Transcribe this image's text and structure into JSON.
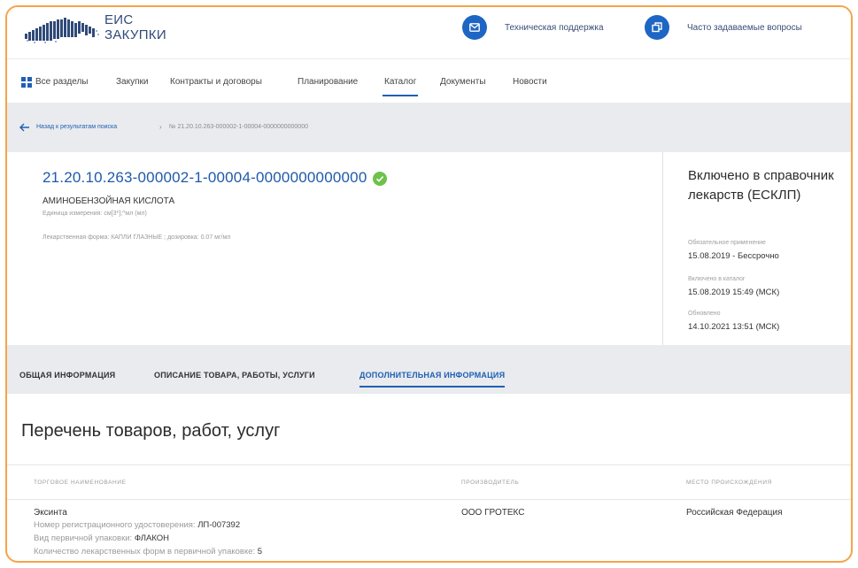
{
  "header": {
    "logo_line1": "ЕИС",
    "logo_line2": "ЗАКУПКИ",
    "support_label": "Техническая поддержка",
    "faq_label": "Часто задаваемые вопросы"
  },
  "nav": {
    "items": [
      "Все разделы",
      "Закупки",
      "Контракты и договоры",
      "Планирование",
      "Каталог",
      "Документы",
      "Новости"
    ],
    "active": "Каталог"
  },
  "breadcrumb": {
    "back": "Назад к результатам поиска",
    "separator": "›",
    "current": "№ 21.20.10.263-000002-1-00004-0000000000000"
  },
  "item": {
    "code": "21.20.10.263-000002-1-00004-0000000000000",
    "name": "АМИНОБЕНЗОЙНАЯ КИСЛОТА",
    "unit": "Единица измерения: см[3*];^мл (мл)",
    "form": "Лекарственная форма: КАПЛИ ГЛАЗНЫЕ ; дозировка: 0.07 мг/мл"
  },
  "status": {
    "title": "Включено в справочник лекарств (ЕСКЛП)",
    "mandatory_label": "Обязательное применение",
    "mandatory_value": "15.08.2019  - Бессрочно",
    "included_label": "Включено в каталог",
    "included_value": "15.08.2019 15:49 (МСК)",
    "updated_label": "Обновлено",
    "updated_value": "14.10.2021 13:51 (МСК)"
  },
  "tabs": {
    "items": [
      "ОБЩАЯ ИНФОРМАЦИЯ",
      "ОПИСАНИЕ ТОВАРА, РАБОТЫ, УСЛУГИ",
      "ДОПОЛНИТЕЛЬНАЯ ИНФОРМАЦИЯ"
    ],
    "active": "ДОПОЛНИТЕЛЬНАЯ ИНФОРМАЦИЯ"
  },
  "list": {
    "title": "Перечень товаров, работ, услуг",
    "headers": [
      "ТОРГОВОЕ НАИМЕНОВАНИЕ",
      "ПРОИЗВОДИТЕЛЬ",
      "МЕСТО ПРОИСХОЖДЕНИЯ"
    ],
    "row": {
      "trade_name": "Эксинта",
      "reg_label": "Номер регистрационного удостоверения:",
      "reg_value": "ЛП-007392",
      "pack_label": "Вид первичной упаковки:",
      "pack_value": "ФЛАКОН",
      "qty_label": "Количество лекарственных форм в первичной упаковке:",
      "qty_value": "5",
      "manufacturer": "ООО ГРОТЕКС",
      "origin": "Российская Федерация"
    }
  },
  "colors": {
    "brand_blue": "#1e66c4",
    "link_blue": "#1f5fb5",
    "frame_orange": "#f7a348",
    "check_green": "#6cc24a",
    "panel_gray": "#e9ebee"
  }
}
